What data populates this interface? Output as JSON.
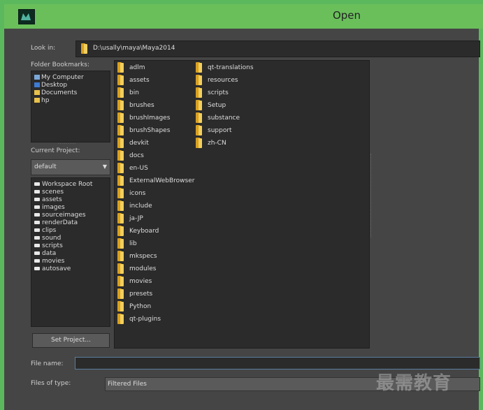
{
  "window": {
    "title": "Open"
  },
  "look_in": {
    "label": "Look in:",
    "path": "D:\\usally\\maya\\Maya2014"
  },
  "bookmarks": {
    "label": "Folder Bookmarks:",
    "items": [
      "My Computer",
      "Desktop",
      "Documents",
      "hp"
    ]
  },
  "project": {
    "label": "Current Project:",
    "selected": "default",
    "set_button": "Set Project..."
  },
  "workspace": {
    "items": [
      "Workspace Root",
      "scenes",
      "assets",
      "images",
      "sourceimages",
      "renderData",
      "clips",
      "sound",
      "scripts",
      "data",
      "movies",
      "autosave"
    ]
  },
  "files": {
    "col1": [
      "adlm",
      "assets",
      "bin",
      "brushes",
      "brushImages",
      "brushShapes",
      "devkit",
      "docs",
      "en-US",
      "ExternalWebBrowser",
      "icons",
      "include",
      "ja-JP",
      "Keyboard",
      "lib",
      "mkspecs",
      "modules",
      "movies",
      "presets",
      "Python",
      "qt-plugins"
    ],
    "col2": [
      "qt-translations",
      "resources",
      "scripts",
      "Setup",
      "substance",
      "support",
      "zh-CN"
    ]
  },
  "file_name": {
    "label": "File name:",
    "value": ""
  },
  "files_of_type": {
    "label": "Files of type:",
    "value": "Filtered Files"
  },
  "watermark": "最需教育",
  "colors": {
    "title_bar": "#6abf5b",
    "panel": "#2b2b2b",
    "folder": "#f2cf5e"
  }
}
